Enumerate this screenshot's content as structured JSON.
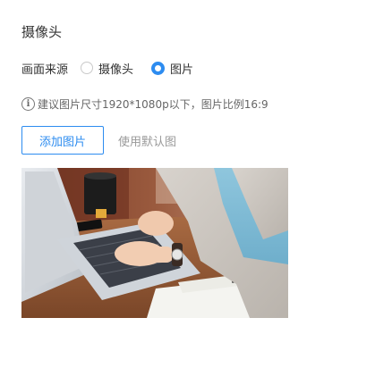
{
  "section": {
    "title": "摄像头"
  },
  "source": {
    "label": "画面来源",
    "options": [
      {
        "label": "摄像头",
        "checked": false
      },
      {
        "label": "图片",
        "checked": true
      }
    ]
  },
  "hint": {
    "icon": "info-icon",
    "text": "建议图片尺寸1920*1080p以下，图片比例16:9"
  },
  "actions": {
    "add_image_label": "添加图片",
    "use_default_label": "使用默认图"
  },
  "colors": {
    "accent": "#2d8cf0",
    "text": "#333333",
    "muted": "#999999"
  }
}
